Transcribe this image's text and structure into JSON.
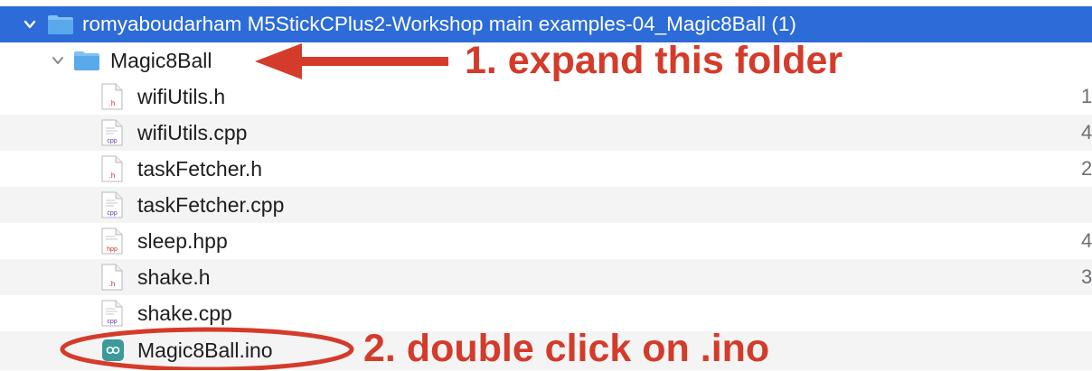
{
  "rows": [
    {
      "name": "romyaboudarham M5StickCPlus2-Workshop main examples-04_Magic8Ball (1)",
      "kind": "folder",
      "expanded": true,
      "selected": true
    },
    {
      "name": "Magic8Ball",
      "kind": "folder",
      "expanded": true
    },
    {
      "name": "wifiUtils.h",
      "kind": "file",
      "icon": "h-file-icon",
      "badge": ".h",
      "size": "1"
    },
    {
      "name": "wifiUtils.cpp",
      "kind": "file",
      "icon": "cpp-file-icon",
      "badge": "cpp",
      "size": "4"
    },
    {
      "name": "taskFetcher.h",
      "kind": "file",
      "icon": "h-file-icon",
      "badge": ".h",
      "size": "2"
    },
    {
      "name": "taskFetcher.cpp",
      "kind": "file",
      "icon": "cpp-file-icon",
      "badge": "cpp",
      "size": ""
    },
    {
      "name": "sleep.hpp",
      "kind": "file",
      "icon": "hpp-file-icon",
      "badge": "hpp",
      "size": "4"
    },
    {
      "name": "shake.h",
      "kind": "file",
      "icon": "h-file-icon",
      "badge": ".h",
      "size": "3"
    },
    {
      "name": "shake.cpp",
      "kind": "file",
      "icon": "cpp-file-icon",
      "badge": "cpp",
      "size": ""
    },
    {
      "name": "Magic8Ball.ino",
      "kind": "file",
      "icon": "arduino-file-icon",
      "badge": "",
      "size": ""
    }
  ],
  "annotations": {
    "step1": "1. expand this folder",
    "step2": "2. double click on .ino",
    "color": "#d43b2a"
  },
  "colors": {
    "selection": "#2c6bd8",
    "folder": "#5aa9ea",
    "stripe": "#f4f4f5"
  }
}
